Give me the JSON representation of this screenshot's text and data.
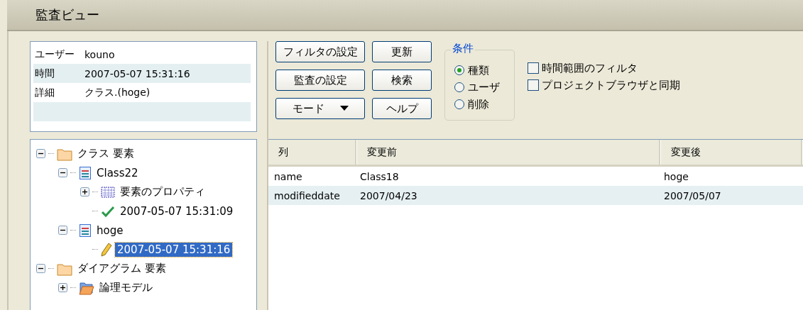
{
  "window": {
    "title": "監査ビュー"
  },
  "details": [
    {
      "label": "ユーザー",
      "value": "kouno"
    },
    {
      "label": "時間",
      "value": "2007-05-07 15:31:16"
    },
    {
      "label": "詳細",
      "value": "クラス.(hoge)"
    }
  ],
  "tree": [
    {
      "label": "クラス 要素",
      "kind": "folder",
      "expanded": true,
      "selected": false,
      "children": [
        {
          "label": "Class22",
          "kind": "class",
          "expanded": true,
          "selected": false,
          "children": [
            {
              "label": "要素のプロパティ",
              "kind": "grid",
              "expanded": false,
              "selected": false
            },
            {
              "label": "2007-05-07 15:31:09",
              "kind": "check",
              "selected": false
            }
          ]
        },
        {
          "label": "hoge",
          "kind": "class",
          "expanded": true,
          "selected": false,
          "children": [
            {
              "label": "2007-05-07 15:31:16",
              "kind": "pencil",
              "selected": true
            }
          ]
        }
      ]
    },
    {
      "label": "ダイアグラム 要素",
      "kind": "folder",
      "expanded": true,
      "selected": false,
      "children": [
        {
          "label": "論理モデル",
          "kind": "openfolder",
          "expanded": false,
          "selected": false
        }
      ]
    }
  ],
  "buttons": [
    {
      "label": "フィルタの設定",
      "kind": "plain"
    },
    {
      "label": "更新",
      "kind": "plain"
    },
    {
      "label": "監査の設定",
      "kind": "plain"
    },
    {
      "label": "検索",
      "kind": "plain"
    },
    {
      "label": "モード",
      "kind": "dropdown"
    },
    {
      "label": "ヘルプ",
      "kind": "plain"
    }
  ],
  "condition": {
    "title": "条件",
    "options": [
      {
        "label": "種類",
        "selected": true
      },
      {
        "label": "ユーザ",
        "selected": false
      },
      {
        "label": "削除",
        "selected": false
      }
    ]
  },
  "checkboxes": [
    {
      "label": "時間範囲のフィルタ",
      "checked": false
    },
    {
      "label": "プロジェクトブラウザと同期",
      "checked": false
    }
  ],
  "table": {
    "columns": [
      "列",
      "変更前",
      "変更後"
    ],
    "rows": [
      [
        "name",
        "Class18",
        "hoge"
      ],
      [
        "modifieddate",
        "2007/04/23",
        "2007/05/07"
      ]
    ]
  }
}
